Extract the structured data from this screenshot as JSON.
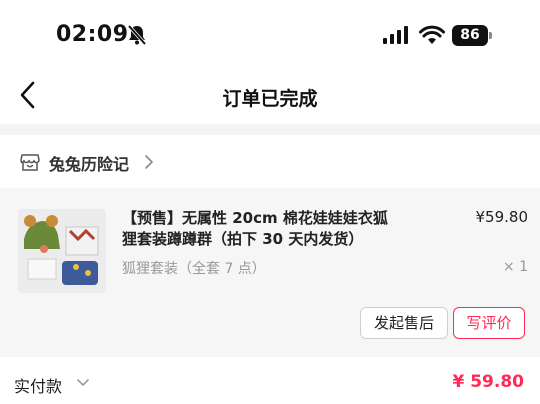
{
  "status_bar": {
    "time": "02:09",
    "battery": "86",
    "icons": [
      "bell-slash-icon",
      "signal-icon",
      "wifi-icon",
      "battery-icon"
    ]
  },
  "nav": {
    "title": "订单已完成",
    "back_icon": "chevron-left-icon"
  },
  "shop": {
    "name": "兔兔历险记",
    "icon": "store-icon"
  },
  "product": {
    "title": "【预售】无属性 20cm 棉花娃娃娃衣狐狸套装蹲蹲群（拍下 30 天内发货）",
    "price": "¥59.80",
    "variant": "狐狸套装（全套 7 点）",
    "quantity": "× 1"
  },
  "actions": {
    "after_sale": "发起售后",
    "review": "写评价"
  },
  "payment": {
    "label": "实付款",
    "amount": "¥ 59.80"
  },
  "colors": {
    "accent": "#ff2a55",
    "background": "#f4f4f4"
  }
}
